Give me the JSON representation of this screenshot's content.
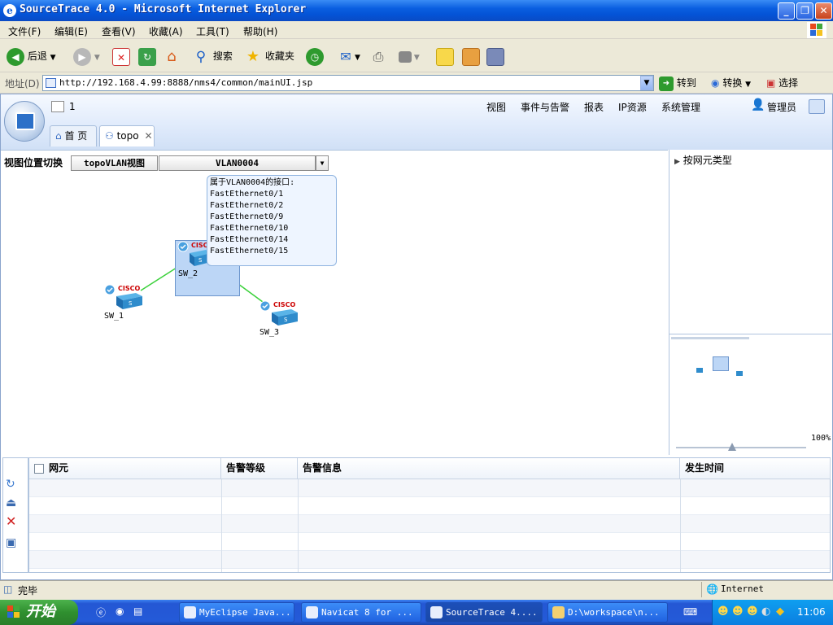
{
  "window": {
    "title": "SourceTrace 4.0 - Microsoft Internet Explorer"
  },
  "menu": [
    "文件(F)",
    "编辑(E)",
    "查看(V)",
    "收藏(A)",
    "工具(T)",
    "帮助(H)"
  ],
  "toolbar": {
    "back": "后退",
    "search": "搜索",
    "favorites": "收藏夹"
  },
  "address": {
    "label": "地址(D)",
    "url": "http://192.168.4.99:8888/nms4/common/mainUI.jsp",
    "go": "转到",
    "convert": "转换",
    "select": "选择"
  },
  "app": {
    "counter": "1",
    "nav": [
      "视图",
      "事件与告警",
      "报表",
      "IP资源",
      "系统管理"
    ],
    "user": "管理员",
    "tabs": {
      "home": "首 页",
      "topo": "topo"
    },
    "view_switch_label": "视图位置切换",
    "view_mode": "topoVLAN视图",
    "vlan": "VLAN0004",
    "tooltip": {
      "title": "属于VLAN0004的接口:",
      "ports": [
        "FastEthernet0/1",
        "FastEthernet0/2",
        "FastEthernet0/9",
        "FastEthernet0/10",
        "FastEthernet0/14",
        "FastEthernet0/15"
      ]
    },
    "devices": [
      {
        "name": "SW_1",
        "brand": "CISCO"
      },
      {
        "name": "SW_2",
        "brand": "CISCO"
      },
      {
        "name": "SW_3",
        "brand": "CISCO"
      }
    ],
    "side": {
      "tree_root": "按网元类型",
      "zoom": "100%"
    },
    "grid": {
      "headers": [
        "网元",
        "告警等级",
        "告警信息",
        "发生时间"
      ]
    }
  },
  "status": {
    "text": "完毕",
    "zone": "Internet"
  },
  "taskbar": {
    "start": "开始",
    "tasks": [
      "MyEclipse Java...",
      "Navicat 8 for ...",
      "SourceTrace 4....",
      "D:\\workspace\\n..."
    ],
    "clock": "11:06"
  },
  "colors": {
    "link": "#3bd13b",
    "accent": "#2457d4",
    "selection": "#bcd6f6"
  }
}
